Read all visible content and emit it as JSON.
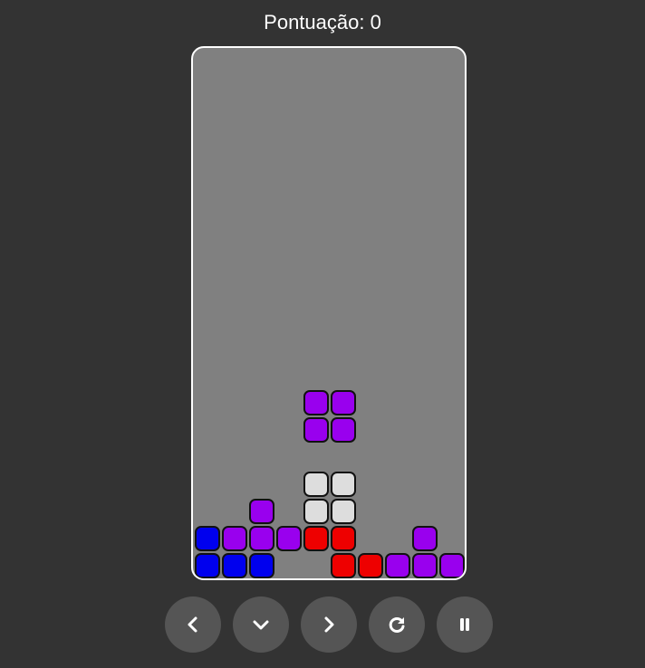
{
  "score": {
    "label": "Pontuação: 0",
    "value": 0
  },
  "board": {
    "columns": 10,
    "rows": 19,
    "colors": {
      "P": "#9900ee",
      "B": "#0000ee",
      "R": "#ee0000",
      "W": "#dddddd"
    },
    "grid": [
      "..........",
      "..........",
      "..........",
      "..........",
      "..........",
      "..........",
      "..........",
      "..........",
      "..........",
      "..........",
      "..........",
      "..........",
      "..........",
      "..........",
      "..........",
      "..........",
      "..........",
      "..........",
      ".........."
    ],
    "placed": [
      {
        "row": 13,
        "col": 4,
        "c": "P"
      },
      {
        "row": 13,
        "col": 5,
        "c": "P"
      },
      {
        "row": 14,
        "col": 4,
        "c": "P"
      },
      {
        "row": 14,
        "col": 5,
        "c": "P"
      },
      {
        "row": 16,
        "col": 4,
        "c": "W"
      },
      {
        "row": 16,
        "col": 5,
        "c": "W"
      },
      {
        "row": 17,
        "col": 2,
        "c": "P"
      },
      {
        "row": 17,
        "col": 4,
        "c": "W"
      },
      {
        "row": 17,
        "col": 5,
        "c": "W"
      },
      {
        "row": 18,
        "col": 0,
        "c": "B"
      },
      {
        "row": 18,
        "col": 1,
        "c": "P"
      },
      {
        "row": 18,
        "col": 2,
        "c": "P"
      },
      {
        "row": 18,
        "col": 3,
        "c": "P"
      },
      {
        "row": 18,
        "col": 4,
        "c": "R"
      },
      {
        "row": 18,
        "col": 5,
        "c": "R"
      },
      {
        "row": 18,
        "col": 8,
        "c": "P"
      },
      {
        "row": 19,
        "col": 0,
        "c": "B"
      },
      {
        "row": 19,
        "col": 1,
        "c": "B"
      },
      {
        "row": 19,
        "col": 2,
        "c": "B"
      },
      {
        "row": 19,
        "col": 5,
        "c": "R"
      },
      {
        "row": 19,
        "col": 6,
        "c": "R"
      },
      {
        "row": 19,
        "col": 7,
        "c": "P"
      },
      {
        "row": 19,
        "col": 8,
        "c": "P"
      },
      {
        "row": 19,
        "col": 9,
        "c": "P"
      }
    ]
  },
  "controls": [
    {
      "name": "move-left-button",
      "icon": "chevron-left-icon"
    },
    {
      "name": "move-down-button",
      "icon": "chevron-down-icon"
    },
    {
      "name": "move-right-button",
      "icon": "chevron-right-icon"
    },
    {
      "name": "rotate-button",
      "icon": "rotate-icon"
    },
    {
      "name": "pause-button",
      "icon": "pause-icon"
    }
  ]
}
